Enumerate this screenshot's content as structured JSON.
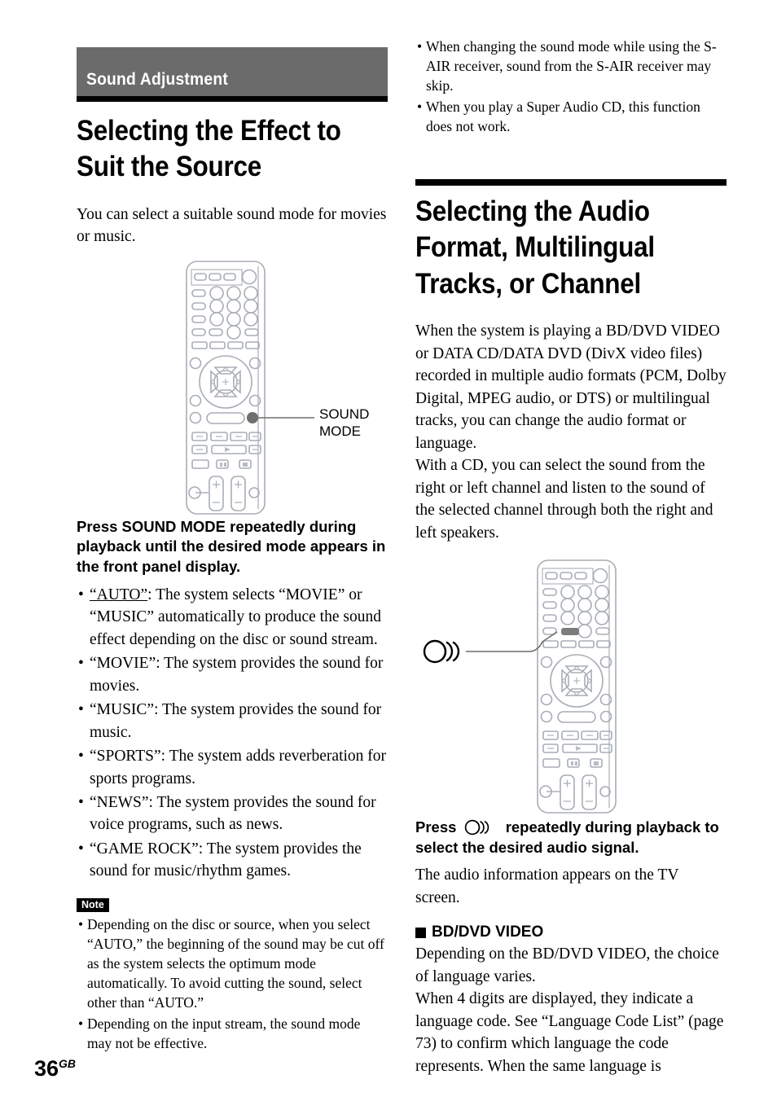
{
  "page": {
    "number": "36",
    "region_suffix": "GB"
  },
  "left_column": {
    "section_banner": "Sound Adjustment",
    "heading": "Selecting the Effect to Suit the Source",
    "lead_paragraph": "You can select a suitable sound mode for movies or music.",
    "remote_figure": {
      "callout_label": "SOUND\nMODE",
      "highlighted_button": "sound-mode-button"
    },
    "instruction": "Press SOUND MODE repeatedly during playback until the desired mode appears in the front panel display.",
    "mode_bullets": [
      {
        "mode": "AUTO",
        "underlined": true,
        "text": "“AUTO”: The system selects “MOVIE” or “MUSIC” automatically to produce the sound effect depending on the disc or sound stream."
      },
      {
        "mode": "MOVIE",
        "underlined": false,
        "text": "“MOVIE”: The system provides the sound for movies."
      },
      {
        "mode": "MUSIC",
        "underlined": false,
        "text": "“MUSIC”: The system provides the sound for music."
      },
      {
        "mode": "SPORTS",
        "underlined": false,
        "text": "“SPORTS”: The system adds reverberation for sports programs."
      },
      {
        "mode": "NEWS",
        "underlined": false,
        "text": "“NEWS”: The system provides the sound for voice programs, such as news."
      },
      {
        "mode": "GAME ROCK",
        "underlined": false,
        "text": "“GAME ROCK”: The system provides the sound for music/rhythm games."
      }
    ],
    "note": {
      "badge": "Note",
      "items": [
        "Depending on the disc or source, when you select “AUTO,” the beginning of the sound may be cut off as the system selects the optimum mode automatically. To avoid cutting the sound, select other than “AUTO.”",
        "Depending on the input stream, the sound mode may not be effective."
      ]
    }
  },
  "right_column": {
    "top_note_items": [
      "When changing the sound mode while using the S-AIR receiver, sound from the S-AIR receiver may skip.",
      "When you play a Super Audio CD, this function does not work."
    ],
    "heading": "Selecting the Audio Format, Multilingual Tracks, or Channel",
    "paragraphs": [
      "When the system is playing a BD/DVD VIDEO or DATA CD/DATA DVD (DivX video files) recorded in multiple audio formats (PCM, Dolby Digital, MPEG audio, or DTS) or multilingual tracks, you can change the audio format or language.",
      "With a CD, you can select the sound from the right or left channel and listen to the sound of the selected channel through both the right and left speakers."
    ],
    "remote_figure": {
      "callout_icon": "audio-icon",
      "highlighted_button": "audio-button"
    },
    "instruction_before_icon": "Press",
    "instruction_after_icon": "repeatedly during playback to select the desired audio signal.",
    "instruction_follow_up": "The audio information appears on the TV screen.",
    "sub_heading": "BD/DVD VIDEO",
    "sub_paragraphs": [
      "Depending on the BD/DVD VIDEO, the choice of language varies.",
      "When 4 digits are displayed, they indicate a language code. See “Language Code List” (page 73) to confirm which language the code represents. When the same language is"
    ]
  },
  "colors": {
    "banner_gray": "#6b6b6b",
    "rule_black": "#000000",
    "remote_outline": "#a8adb5",
    "highlight_fill": "#808080"
  }
}
